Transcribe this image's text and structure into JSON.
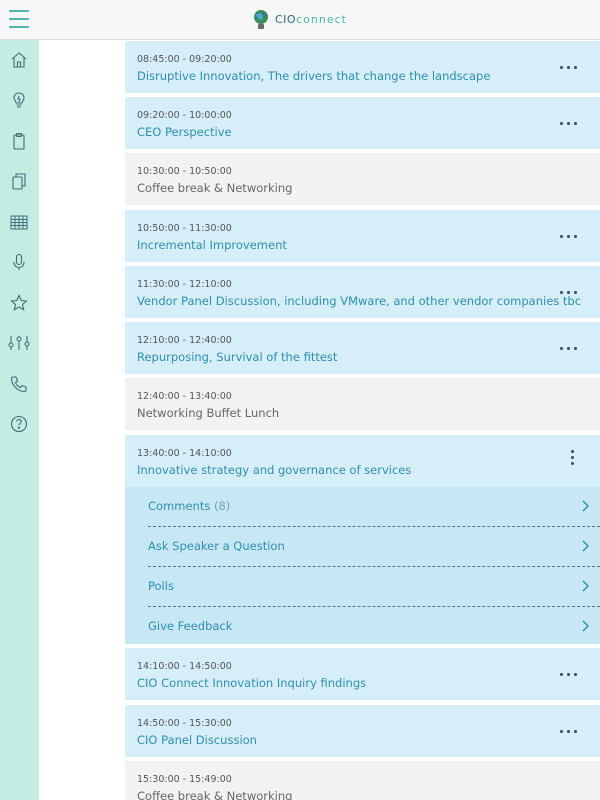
{
  "header": {
    "logo_bold": "CIO",
    "logo_light": "connect"
  },
  "sidebar": {
    "items": [
      {
        "icon": "home-icon"
      },
      {
        "icon": "lightbulb-icon"
      },
      {
        "icon": "clipboard-icon"
      },
      {
        "icon": "documents-icon"
      },
      {
        "icon": "calendar-icon"
      },
      {
        "icon": "microphone-icon"
      },
      {
        "icon": "star-icon"
      },
      {
        "icon": "sliders-icon"
      },
      {
        "icon": "phone-icon"
      },
      {
        "icon": "help-icon"
      }
    ]
  },
  "colors": {
    "accent": "#4ab5a8",
    "sidebar_bg": "#c3ede3",
    "session_bg": "#d6eef9",
    "break_bg": "#f2f2f2",
    "title_blue": "#2d8fb0"
  },
  "agenda": {
    "sessions": [
      {
        "time": "08:45:00 - 09:20:00",
        "title": "Disruptive Innovation, The drivers that change the landscape"
      },
      {
        "time": "09:20:00 - 10:00:00",
        "title": "CEO Perspective"
      },
      {
        "time": "10:30:00 - 10:50:00",
        "title": "Coffee break & Networking"
      },
      {
        "time": "10:50:00 - 11:30:00",
        "title": "Incremental Improvement"
      },
      {
        "time": "11:30:00 - 12:10:00",
        "title": "Vendor Panel Discussion, including VMware, and other vendor companies tbc"
      },
      {
        "time": "12:10:00 - 12:40:00",
        "title": "Repurposing, Survival of the fittest"
      },
      {
        "time": "12:40:00 - 13:40:00",
        "title": "Networking Buffet Lunch"
      },
      {
        "time": "13:40:00 - 14:10:00",
        "title": "Innovative strategy and governance of services"
      },
      {
        "time": "14:10:00 - 14:50:00",
        "title": "CIO Connect Innovation Inquiry findings"
      },
      {
        "time": "14:50:00 - 15:30:00",
        "title": "CIO Panel Discussion"
      },
      {
        "time": "15:30:00 - 15:49:00",
        "title": "Coffee break & Networking"
      }
    ],
    "expanded_menu": {
      "comments_label": "Comments",
      "comments_count": "(8)",
      "ask_label": "Ask Speaker a Question",
      "polls_label": "Polls",
      "feedback_label": "Give Feedback"
    }
  }
}
